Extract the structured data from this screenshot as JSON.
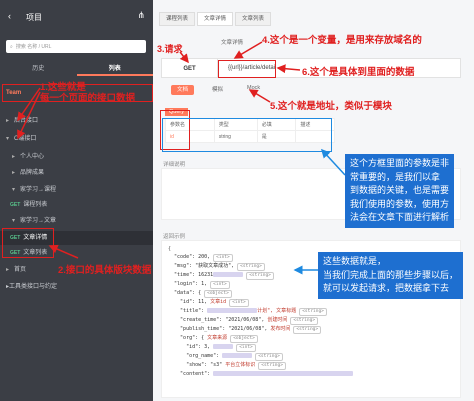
{
  "sidebar": {
    "title": "项目",
    "search_placeholder": "搜索 名称 / URL",
    "tabs": [
      {
        "label": "历史"
      },
      {
        "label": "列表"
      }
    ],
    "team_label": "Team",
    "tree": [
      {
        "label": "后台接口",
        "type": "folder"
      },
      {
        "label": "C端接口",
        "type": "folder"
      },
      {
        "label": "个人中心",
        "type": "item"
      },
      {
        "label": "品牌成果",
        "type": "item"
      },
      {
        "label": "家学习→课程",
        "type": "item"
      },
      {
        "label": "课程列表",
        "type": "get",
        "method": "GET"
      },
      {
        "label": "家学习→文章",
        "type": "item"
      },
      {
        "label": "文章详情",
        "type": "get",
        "method": "GET",
        "selected": true
      },
      {
        "label": "文章列表",
        "type": "get",
        "method": "GET"
      },
      {
        "label": "首页",
        "type": "item"
      }
    ],
    "footer": "工具类接口与约定"
  },
  "main": {
    "tabs": [
      {
        "label": "课程列表"
      },
      {
        "label": "文章详情",
        "active": true
      },
      {
        "label": "文章列表"
      }
    ],
    "method": "GET",
    "col_label": "文章详情",
    "url": "{{url}}/article/detail",
    "subtabs": [
      {
        "label": "文档",
        "active": true
      },
      {
        "label": "模拟"
      },
      {
        "label": "Mock"
      }
    ],
    "query_label": "Query",
    "param_headers": [
      "参数名",
      "类型",
      "必填",
      "描述"
    ],
    "param_rows": [
      {
        "name": "id",
        "type": "string",
        "required": "是",
        "desc": ""
      }
    ],
    "desc_label": "详细说明",
    "example_label": "返回示例"
  },
  "json_lines": {
    "l1": "{",
    "code_key": "\"code\": 200,",
    "msg_key": "\"msg\": \"获取文章成功\",",
    "time_key": "\"time\": 16231",
    "login_key": "\"login\": 1,",
    "data_key": "\"data\": {",
    "id_key": "\"id\": 11,",
    "id_note": "文章id",
    "title_key": "\"title\":",
    "title_note": "计划\", 文章标题",
    "ct_key": "\"create_time\": \"2021/06/08\",",
    "ct_note": "创建时间",
    "pt_key": "\"publish_time\": \"2021/06/08\",",
    "pt_note": "发布时间",
    "org_key": "\"org\": {",
    "org_note": "文章来源",
    "oid_key": "\"id\": 3,",
    "oname_key": "\"org_name\":",
    "oshow_key": "\"show\": \"s3\"",
    "oshow_note": "平台立体标识",
    "content_key": "\"content\":",
    "type_string": "<string>",
    "type_object": "<object>",
    "type_int": "<int>"
  },
  "annotations": {
    "a1": "1.这些就是\n每一个页面的接口数据",
    "a2": "2.接口的具体版块数据",
    "a3": "3.请求",
    "a4": "4.这个是一个变量，是用来存放域名的",
    "a5": "5.这个就是地址，类似于模块",
    "a6": "6.这个是具体到里面的数据",
    "blue1": "这个方框里面的参数是非\n常重要的，是我们以拿\n到数据的关键，也是需要\n我们使用的参数，使用方\n法会在文章下面进行解析",
    "blue2": "这些数据就是，\n当我们完成上面的那些步骤以后，\n就可以发起请求，把数据拿下去"
  }
}
